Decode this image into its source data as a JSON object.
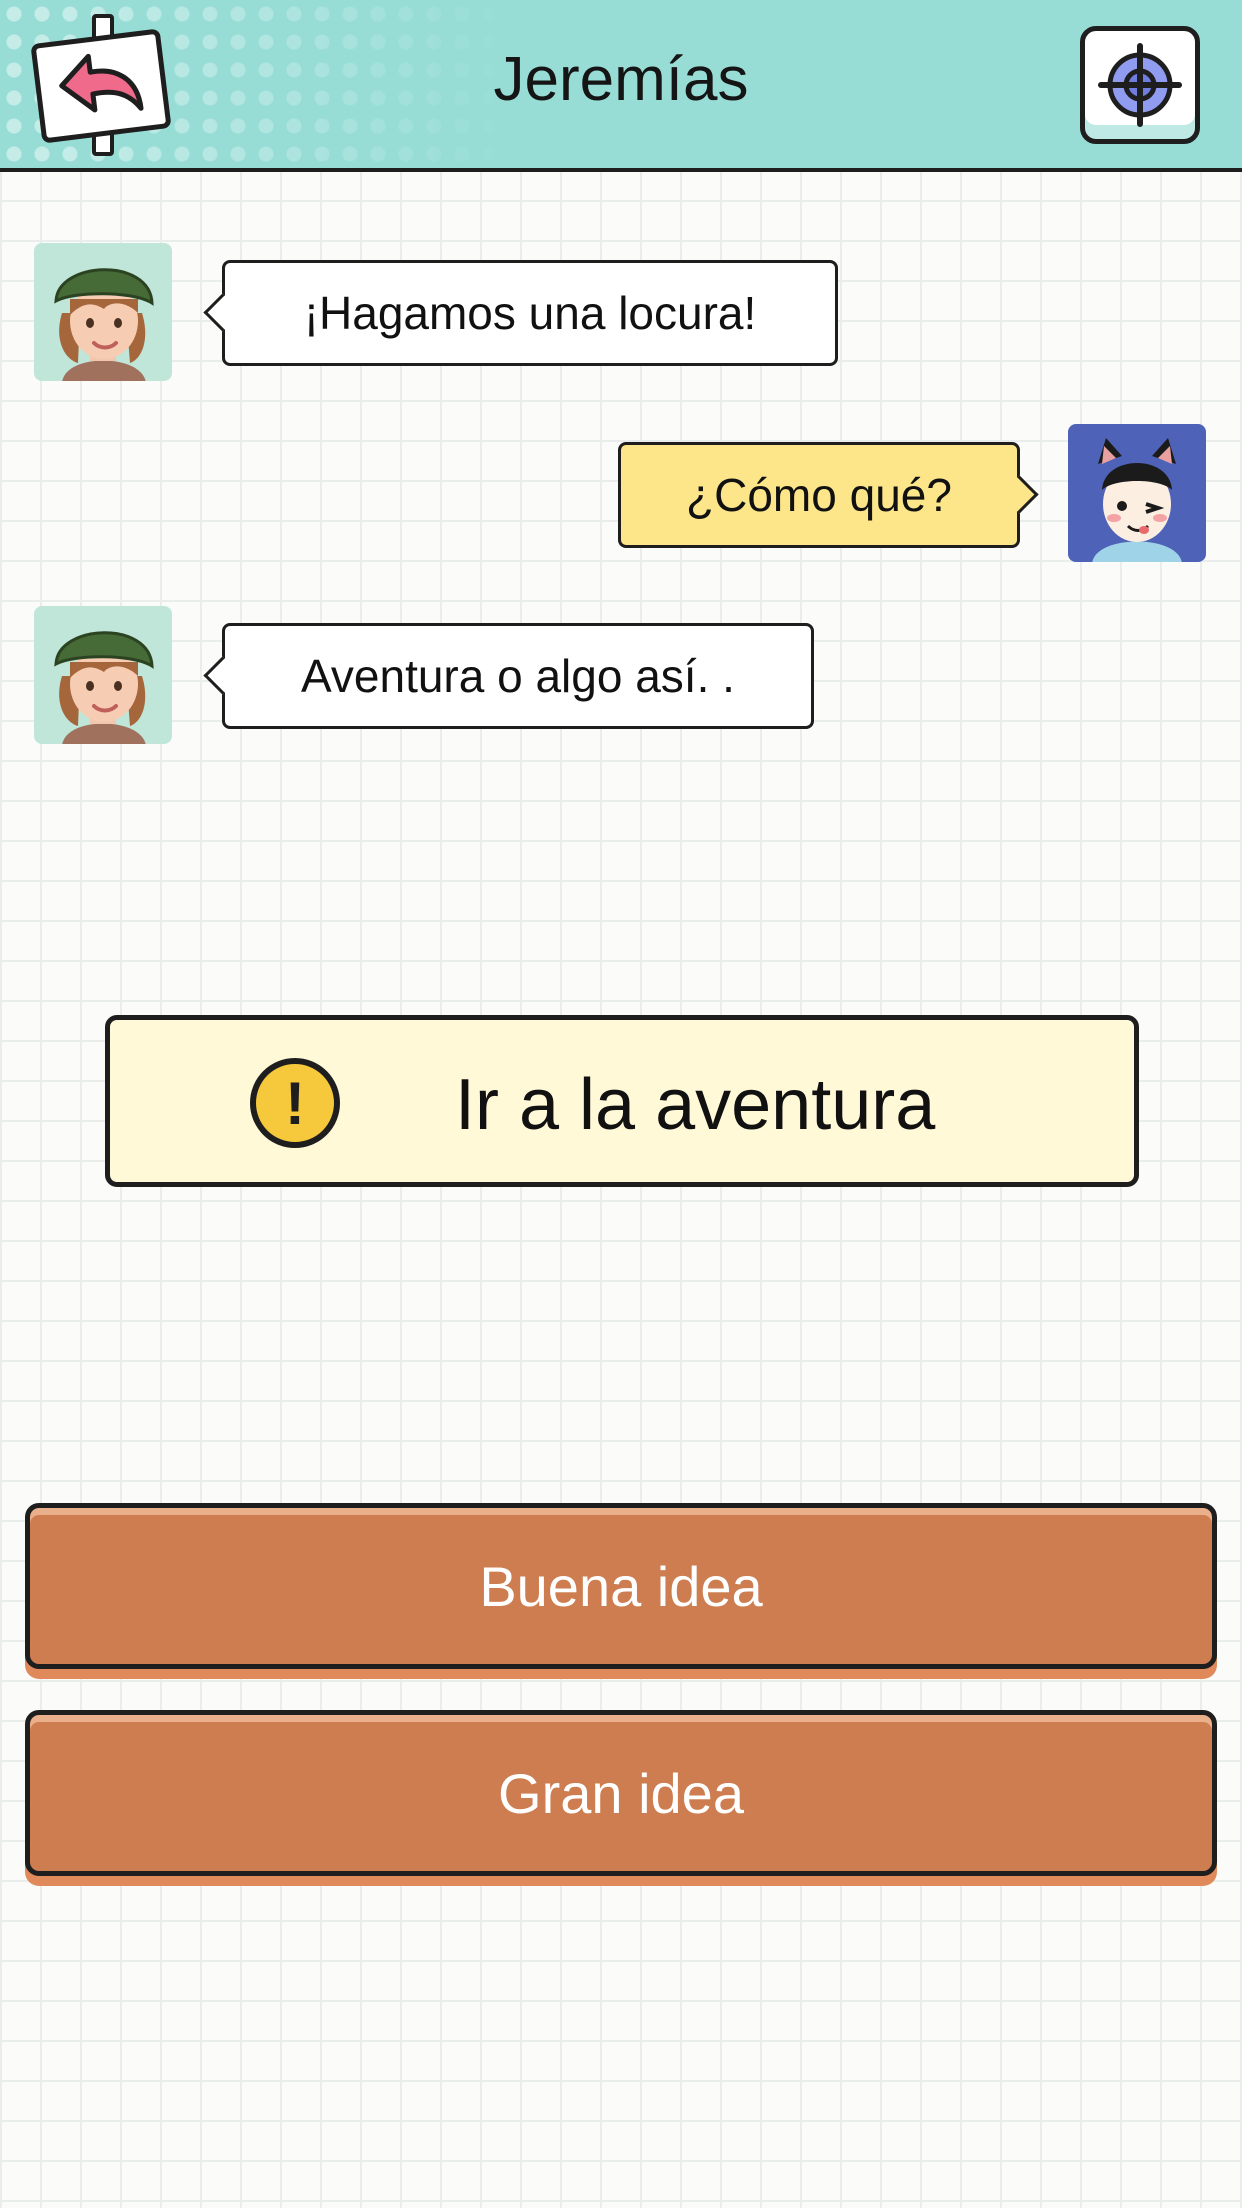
{
  "header": {
    "title": "Jeremías",
    "back_icon": "back-arrow-sign-icon",
    "target_icon": "crosshair-target-icon",
    "colors": {
      "bar": "#97ddd6",
      "back_arrow": "#f06a8c",
      "target": "#6f7de0"
    }
  },
  "chat": {
    "messages": [
      {
        "sender": "contact",
        "avatar": "girl-green-beanie-avatar",
        "text": "¡Hagamos una locura!"
      },
      {
        "sender": "player",
        "avatar": "boy-cat-ears-avatar",
        "text": "¿Cómo qué?"
      },
      {
        "sender": "contact",
        "avatar": "girl-green-beanie-avatar",
        "text": "Aventura o algo así. ."
      }
    ]
  },
  "event": {
    "icon": "exclamation-warning-icon",
    "label": "Ir a la aventura"
  },
  "choices": [
    {
      "label": "Buena idea"
    },
    {
      "label": "Gran idea"
    }
  ],
  "colors": {
    "player_bubble": "#fde58a",
    "event_banner": "#fff9d8",
    "choice_button": "#cd7d4f"
  }
}
